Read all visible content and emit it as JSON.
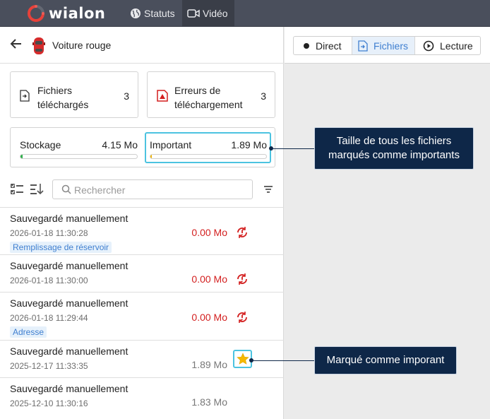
{
  "topbar": {
    "logo_text": "wialon",
    "nav": [
      {
        "label": "Statuts",
        "icon": "globe-icon"
      },
      {
        "label": "Vidéo",
        "icon": "video-camera-icon"
      }
    ]
  },
  "unit": {
    "name": "Voiture rouge",
    "icon": "red-car-icon"
  },
  "cards": {
    "downloaded": {
      "label": "Fichiers téléchargés",
      "count": "3"
    },
    "errors": {
      "label": "Erreurs de téléchargement",
      "count": "3"
    }
  },
  "storage": {
    "storage_label": "Stockage",
    "storage_value": "4.15 Mo",
    "storage_fill_fraction": 0.02,
    "important_label": "Important",
    "important_value": "1.89 Mo",
    "important_fill_fraction": 0.01
  },
  "search": {
    "placeholder": "Rechercher"
  },
  "files": [
    {
      "title": "Sauvegardé manuellement",
      "date": "2026-01-18 11:30:28",
      "tag": "Remplissage de réservoir",
      "size": "0.00 Mo",
      "status": "error",
      "action_icon": "retry-download-icon"
    },
    {
      "title": "Sauvegardé manuellement",
      "date": "2026-01-18 11:30:00",
      "tag": "",
      "size": "0.00 Mo",
      "status": "error",
      "action_icon": "retry-download-icon"
    },
    {
      "title": "Sauvegardé manuellement",
      "date": "2026-01-18 11:29:44",
      "tag": "Adresse",
      "size": "0.00 Mo",
      "status": "error",
      "action_icon": "retry-download-icon"
    },
    {
      "title": "Sauvegardé manuellement",
      "date": "2025-12-17 11:33:35",
      "tag": "",
      "size": "1.89 Mo",
      "status": "ok",
      "action_icon": "star-icon"
    },
    {
      "title": "Sauvegardé manuellement",
      "date": "2025-12-10 11:30:16",
      "tag": "",
      "size": "1.83 Mo",
      "status": "ok",
      "action_icon": ""
    }
  ],
  "tabs": [
    {
      "label": "Direct",
      "icon": "record-dot-icon",
      "active": false
    },
    {
      "label": "Fichiers",
      "icon": "file-icon",
      "active": true
    },
    {
      "label": "Lecture",
      "icon": "play-circle-icon",
      "active": false
    }
  ],
  "callouts": {
    "important_size": "Taille de tous les fichiers marqués comme importants",
    "marked_important": "Marqué comme imporant"
  },
  "colors": {
    "topbar": "#4a4f5c",
    "error": "#d31f1f",
    "accent": "#3f7fd0",
    "highlight": "#4cc3e0",
    "callout": "#0e2748",
    "star": "#f5b800"
  }
}
